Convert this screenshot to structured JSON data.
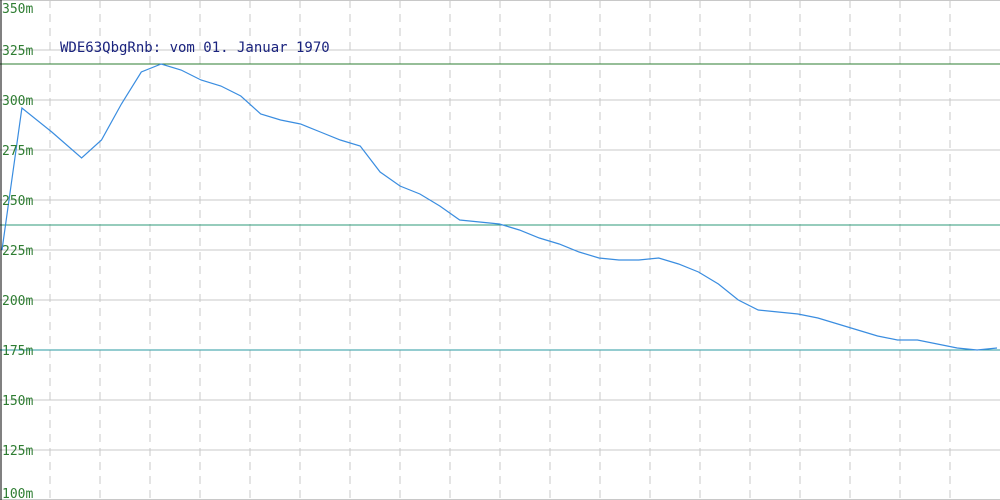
{
  "chart_data": {
    "type": "line",
    "title": "WDE63QbgRnb: vom 01. Januar 1970",
    "xlabel": "",
    "ylabel": "",
    "ylim": [
      100,
      350
    ],
    "y_ticks": [
      "350m",
      "325m",
      "300m",
      "275m",
      "250m",
      "225m",
      "200m",
      "175m",
      "150m",
      "125m",
      "100m"
    ],
    "y_tick_values": [
      350,
      325,
      300,
      275,
      250,
      225,
      200,
      175,
      150,
      125,
      100
    ],
    "grid": true,
    "reference_lines": [
      {
        "value": 318,
        "color": "#2e7d32"
      },
      {
        "value": 237.5,
        "color": "#2e9a7a"
      },
      {
        "value": 175,
        "color": "#2a9aa0"
      }
    ],
    "series": [
      {
        "color": "#3a8de0",
        "x": [
          0,
          2,
          5,
          8,
          10,
          12,
          14,
          16,
          18,
          20,
          22,
          24,
          26,
          28,
          30,
          32,
          34,
          36,
          38,
          40,
          42,
          44,
          46,
          48,
          50,
          52,
          54,
          56,
          58,
          60,
          62,
          64,
          66,
          68,
          70,
          72,
          74,
          76,
          78,
          80,
          82,
          84,
          86,
          88,
          90,
          92,
          94,
          96,
          98,
          100
        ],
        "y": [
          225,
          296,
          284,
          271,
          280,
          298,
          314,
          318,
          315,
          310,
          307,
          302,
          293,
          290,
          288,
          284,
          280,
          277,
          264,
          257,
          253,
          247,
          240,
          239,
          238,
          235,
          231,
          228,
          224,
          221,
          220,
          220,
          221,
          218,
          214,
          208,
          200,
          195,
          194,
          193,
          191,
          188,
          185,
          182,
          180,
          180,
          178,
          176,
          175,
          176
        ]
      }
    ]
  }
}
